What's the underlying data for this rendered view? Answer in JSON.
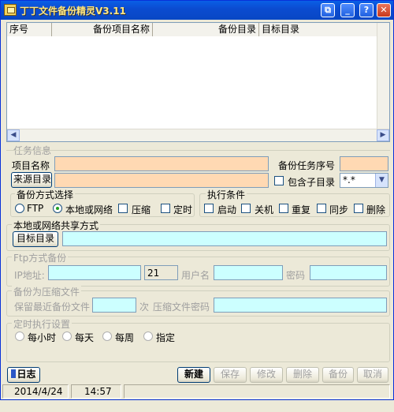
{
  "window": {
    "title": "丁丁文件备份精灵V3.11"
  },
  "titlebar_buttons": {
    "restore": "⧉",
    "minimize": "_",
    "help": "?",
    "close": "✕"
  },
  "grid": {
    "columns": [
      "序号",
      "备份项目名称",
      "备份目录",
      "目标目录"
    ],
    "scroll_left": "◀",
    "scroll_right": "▶"
  },
  "task_info": {
    "legend": "任务信息",
    "project_name_label": "项目名称",
    "project_name_value": "",
    "task_seq_label": "备份任务序号",
    "task_seq_value": "",
    "source_dir_button": "来源目录",
    "source_dir_value": "",
    "include_subdir_label": "包含子目录",
    "filter_value": "*.*",
    "filter_arrow": "▼"
  },
  "backup_method": {
    "legend": "备份方式选择",
    "options": [
      "FTP",
      "本地或网络",
      "压缩",
      "定时"
    ],
    "selected": "本地或网络"
  },
  "exec_conditions": {
    "legend": "执行条件",
    "options": [
      "启动",
      "关机",
      "重复",
      "同步",
      "删除"
    ]
  },
  "local_share": {
    "legend": "本地或网络共享方式",
    "target_dir_button": "目标目录",
    "target_dir_value": ""
  },
  "ftp": {
    "legend": "Ftp方式备份",
    "ip_label": "IP地址:",
    "ip_value": "",
    "port_value": "21",
    "user_label": "用户名",
    "user_value": "",
    "password_label": "密码",
    "password_value": ""
  },
  "compress": {
    "legend": "备份为压缩文件",
    "keep_recent_label": "保留最近备份文件",
    "keep_recent_value": "",
    "times_label": "次",
    "zip_password_label": "压缩文件密码",
    "zip_password_value": ""
  },
  "schedule": {
    "legend": "定时执行设置",
    "options": [
      "每小时",
      "每天",
      "每周",
      "指定"
    ]
  },
  "actions": {
    "log": "日志",
    "new": "新建",
    "save": "保存",
    "modify": "修改",
    "delete": "删除",
    "backup": "备份",
    "cancel": "取消"
  },
  "status": {
    "date": "2014/4/24",
    "time": "14:57"
  }
}
